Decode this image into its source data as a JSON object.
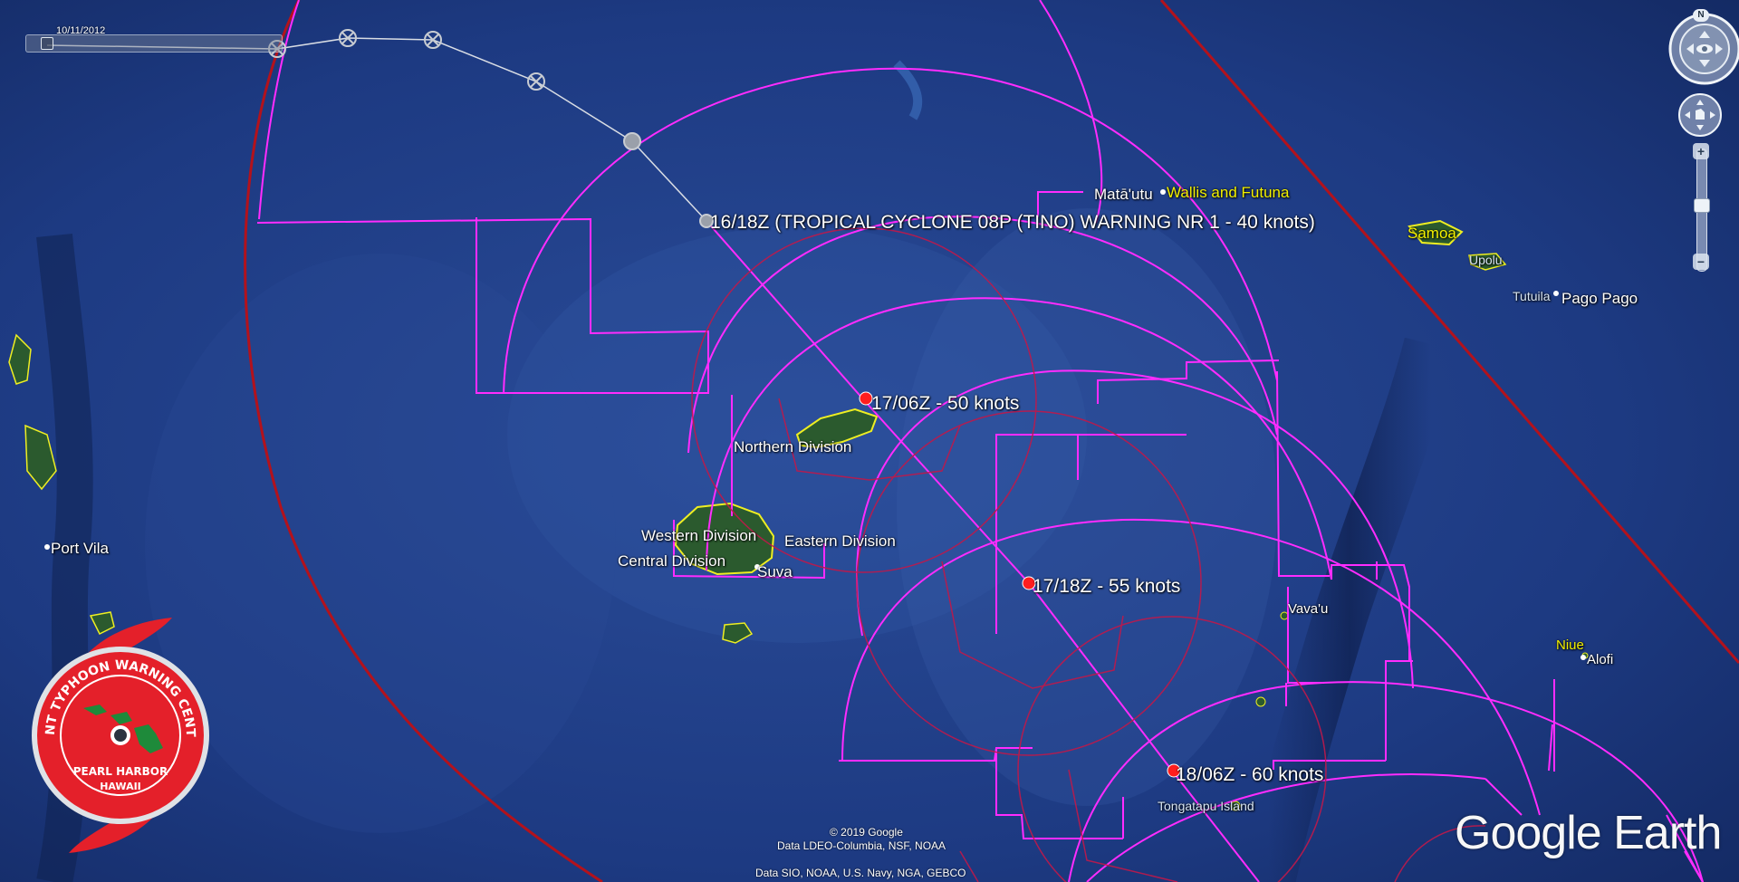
{
  "time_slider": {
    "date": "10/11/2012"
  },
  "warning_header": "16/18Z (TROPICAL CYCLONE 08P (TINO) WARNING NR 1    - 40 knots)",
  "forecast_points": [
    {
      "label": "17/06Z - 50 knots"
    },
    {
      "label": "17/18Z - 55 knots"
    },
    {
      "label": "18/06Z - 60 knots"
    }
  ],
  "place_labels": {
    "matautu": "Matā'utu",
    "wallis_futuna": "Wallis and Futuna",
    "samoa": "Samoa",
    "upolu": "Upolu",
    "tutuila": "Tutuila",
    "pago_pago": "Pago Pago",
    "northern_division": "Northern Division",
    "western_division": "Western Division",
    "eastern_division": "Eastern Division",
    "central_division": "Central Division",
    "suva": "Suva",
    "port_vila": "Port Vila",
    "vavau": "Vava'u",
    "niue": "Niue",
    "alofi": "Alofi",
    "tongatapu": "Tongatapu Island"
  },
  "credits": {
    "copyright": "© 2019 Google",
    "data1": "Data LDEO-Columbia, NSF, NOAA",
    "data2": "Data SIO, NOAA, U.S. Navy, NGA, GEBCO"
  },
  "logo": {
    "ring_text": "JOINT TYPHOON WARNING CENTER",
    "line1": "PEARL HARBOR",
    "line2": "HAWAII",
    "color": "#e4202a"
  },
  "brand": "Google Earth",
  "compass": {
    "north": "N"
  },
  "colors": {
    "ocean": "#1c3a80",
    "radius_magenta": "#ff2cff",
    "danger_red": "#b3121c",
    "inner_rings": "#c0184a",
    "track_past": "#d9dde4",
    "land_outline": "#f0ee20"
  }
}
